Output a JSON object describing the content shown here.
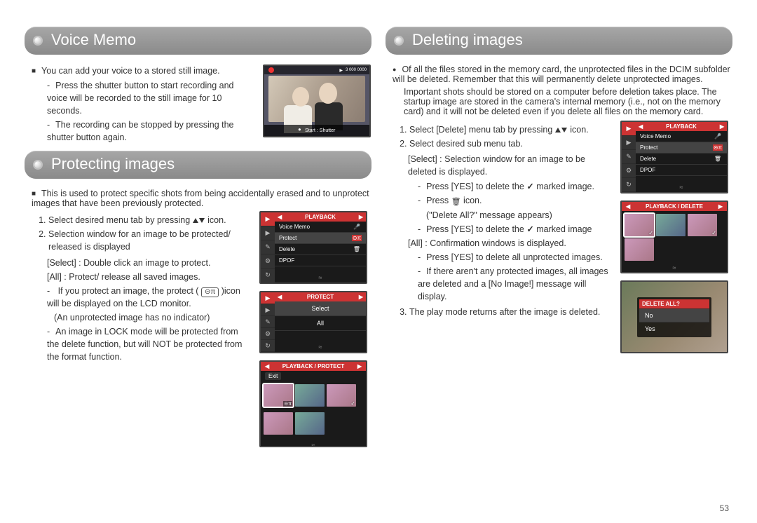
{
  "page_number": 53,
  "voice_memo": {
    "title": "Voice Memo",
    "bullet": "You can add your voice to a stored still image.",
    "dash1": "Press the shutter button to start recording and voice will be recorded to the still image for 10 seconds.",
    "dash2": "The recording can be stopped by pressing the shutter button again.",
    "lcd_topbar": "3 000 0000",
    "lcd_bottom": "Start : Shutter"
  },
  "protecting": {
    "title": "Protecting images",
    "bullet": "This is used to protect specific shots from being accidentally erased and to unprotect images that have been previously protected.",
    "step1_a": "Select desired menu tab by pressing ",
    "step1_b": " icon.",
    "step2": "Selection window for an image to be protected/ released is displayed",
    "select_line": "[Select] : Double click an image to protect.",
    "all_line": "[All] : Protect/ release all saved images.",
    "dash1_a": "If you protect an image, the protect ( ",
    "dash1_key": "⊝π",
    "dash1_b": " )icon will be displayed on the LCD monitor.",
    "dash1_note": "(An unprotected image has no indicator)",
    "dash2": "An image in LOCK mode will be protected from the delete function, but will NOT be protected from the format function.",
    "menu1": {
      "title": "PLAYBACK",
      "rows": [
        "Voice Memo",
        "Protect",
        "Delete",
        "DPOF"
      ],
      "sel_index": 1,
      "icons": [
        "🎤",
        "⊝π",
        "🗑",
        ""
      ]
    },
    "menu2": {
      "title": "PROTECT",
      "opts": [
        "Select",
        "All"
      ]
    },
    "menu3": {
      "title": "PLAYBACK / PROTECT",
      "exit": "Exit"
    }
  },
  "deleting": {
    "title": "Deleting images",
    "bullet": "Of all the files stored in the memory card, the unprotected files in the DCIM subfolder will be deleted. Remember that this will permanently delete unprotected images.",
    "para": "Important shots should be stored on a computer before deletion takes place. The startup image are stored in the camera's internal memory (i.e., not on the memory card) and it will not be deleted even if you delete all files on the memory card.",
    "step1_a": "Select [Delete] menu tab by pressing ",
    "step1_b": " icon.",
    "step2": "Select desired sub menu tab.",
    "select_line": "[Select] : Selection window for an image to be deleted is displayed.",
    "sel_dash1_a": "Press [YES] to delete the ",
    "sel_dash1_b": " marked image.",
    "sel_dash2_a": "Press ",
    "sel_dash2_b": " icon.",
    "sel_dash2_note": "(\"Delete All?\" message appears)",
    "sel_dash3_a": "Press [YES] to delete the ",
    "sel_dash3_b": " marked image",
    "all_line": "[All] : Confirmation windows is displayed.",
    "all_dash1": "Press [YES] to delete all unprotected images.",
    "all_dash2": "If there aren't any protected images, all images are deleted and a [No Image!] message will display.",
    "step3": "The play mode returns after the image is deleted.",
    "menu1": {
      "title": "PLAYBACK",
      "rows": [
        "Voice Memo",
        "Protect",
        "Delete",
        "DPOF"
      ],
      "sel_index": 1,
      "icons": [
        "🎤",
        "⊝π",
        "🗑",
        ""
      ]
    },
    "menu2": {
      "title": "PLAYBACK / DELETE"
    },
    "dialog": {
      "q": "DELETE ALL?",
      "no": "No",
      "yes": "Yes"
    }
  }
}
